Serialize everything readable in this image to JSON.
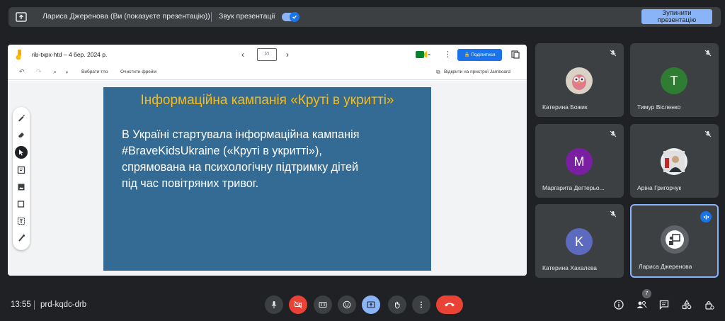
{
  "topbar": {
    "presenter_text": "Лариса Джеренова (Ви (показуєте презентацію))",
    "sound_label": "Звук презентації",
    "stop_button": "Зупинити презентацію"
  },
  "jamboard": {
    "title": "rib-txpx-htd – 4 бер. 2024 р.",
    "frame_label": "1/1",
    "share_label": "Поділитися",
    "set_background": "Вибрати тло",
    "clear_frame": "Очистити фрейм",
    "open_on_device": "Відкрити на пристрої Jamboard"
  },
  "slide": {
    "title": "Інформаційна кампанія «Круті в укритті»",
    "body": "В Україні стартувала інформаційна кампанія\n#BraveKidsUkraine («Круті в укритті»),\nспрямована на психологічну підтримку дітей\nпід час повітряних тривог."
  },
  "participants": [
    {
      "name": "Катерина Божик",
      "avatar": "owl-avatar",
      "initial": ""
    },
    {
      "name": "Тимур Вісленко",
      "avatar": "letter",
      "initial": "T"
    },
    {
      "name": "Маргарита Дегтерьо...",
      "avatar": "letter",
      "initial": "M"
    },
    {
      "name": "Аріна Григорчук",
      "avatar": "photo",
      "initial": ""
    },
    {
      "name": "Катерина Хахалєва",
      "avatar": "letter",
      "initial": "K"
    },
    {
      "name": "Лариса Джеренова",
      "avatar": "presenting",
      "initial": ""
    }
  ],
  "bottombar": {
    "time": "13:55",
    "meeting_code": "prd-kqdc-drb",
    "people_count": "7"
  },
  "colors": {
    "background": "#202124",
    "slide_bg": "#336b94",
    "slide_title": "#f9bc14",
    "accent_blue": "#8ab4f8",
    "red": "#ea4335"
  }
}
